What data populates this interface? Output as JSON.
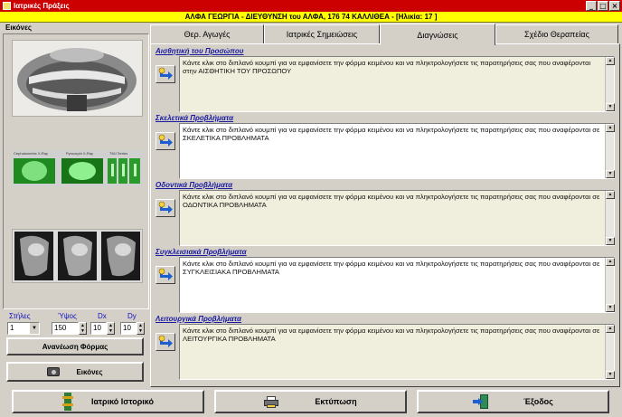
{
  "window": {
    "title": "Ιατρικές Πράξεις"
  },
  "patient_banner": "ΑΛΦΑ ΓΕΩΡΓΙΑ - ΔΙΕΥΘΥΝΣΗ του ΑΛΦΑ, 176 74 ΚΑΛΛΙΘΕΑ - [Ηλικία: 17 ]",
  "left_panel": {
    "title": "Εικόνες",
    "thumb_labels": [
      "Cephalometric X-Ray",
      "Pyrocephi X-Ray",
      "TMJ Series"
    ],
    "controls": {
      "columns_label": "Στήλες",
      "columns_value": "1",
      "height_label": "Ύψος",
      "height_value": "150",
      "dx_label": "Dx",
      "dx_value": "10",
      "dy_label": "Dy",
      "dy_value": "10"
    },
    "refresh_label": "Ανανέωση Φόρμας",
    "images_label": "Εικόνες"
  },
  "tabs": [
    {
      "label": "Θερ. Αγωγές"
    },
    {
      "label": "Ιατρικές Σημειώσεις"
    },
    {
      "label": "Διαγνώσεις"
    },
    {
      "label": "Σχέδιο Θεραπείας"
    }
  ],
  "active_tab": "Διαγνώσεις",
  "sections": [
    {
      "title": "Αισθητική του Προσώπου",
      "text": "Κάντε κλικ στο διπλανό κουμπί για να εμφανίσετε την φόρμα κειμένου και να πληκτρολογήσετε τις παρατηρήσεις σας που αναφέρονται στην ΑΙΣΘΗΤΙΚΗ ΤΟΥ ΠΡΟΣΩΠΟΥ",
      "bg": "#f0eedc"
    },
    {
      "title": "Σκελετικά Προβλήματα",
      "text": "Κάντε κλικ στο διπλανό κουμπί για να εμφανίσετε την φόρμα κειμένου και να πληκτρολογήσετε τις παρατηρήσεις σας που αναφέρονται σε ΣΚΕΛΕΤΙΚΑ ΠΡΟΒΛΗΜΑΤΑ",
      "bg": "#ffffff"
    },
    {
      "title": "Οδοντικά Προβλήματα",
      "text": "Κάντε κλικ στο διπλανό κουμπί για να εμφανίσετε την φόρμα κειμένου και να πληκτρολογήσετε τις παρατηρήσεις σας που αναφέρονται σε ΟΔΟΝΤΙΚΑ ΠΡΟΒΛΗΜΑΤΑ",
      "bg": "#f0eedc"
    },
    {
      "title": "Συγκλεισιακά Προβλήματα",
      "text": "Κάντε κλικ στο διπλανό κουμπί για να εμφανίσετε την φόρμα κειμένου και να πληκτρολογήσετε τις παρατηρήσεις σας που αναφέρονται σε ΣΥΓΚΛΕΙΣΙΑΚΑ ΠΡΟΒΛΗΜΑΤΑ",
      "bg": "#ffffff"
    },
    {
      "title": "Λειτουργικά Προβλήματα",
      "text": "Κάντε κλικ στο διπλανό κουμπί για να εμφανίσετε την φόρμα κειμένου και να πληκτρολογήσετε τις παρατηρήσεις σας που αναφέρονται σε ΛΕΙΤΟΥΡΓΙΚΑ ΠΡΟΒΛΗΜΑΤΑ",
      "bg": "#f0eedc"
    }
  ],
  "bottom_buttons": {
    "history": "Ιατρικό Ιστορικό",
    "print": "Εκτύπωση",
    "exit": "Έξοδος"
  },
  "colors": {
    "titlebar": "#cc0000",
    "banner": "#ffff00",
    "section_title": "#1a1aa0"
  }
}
